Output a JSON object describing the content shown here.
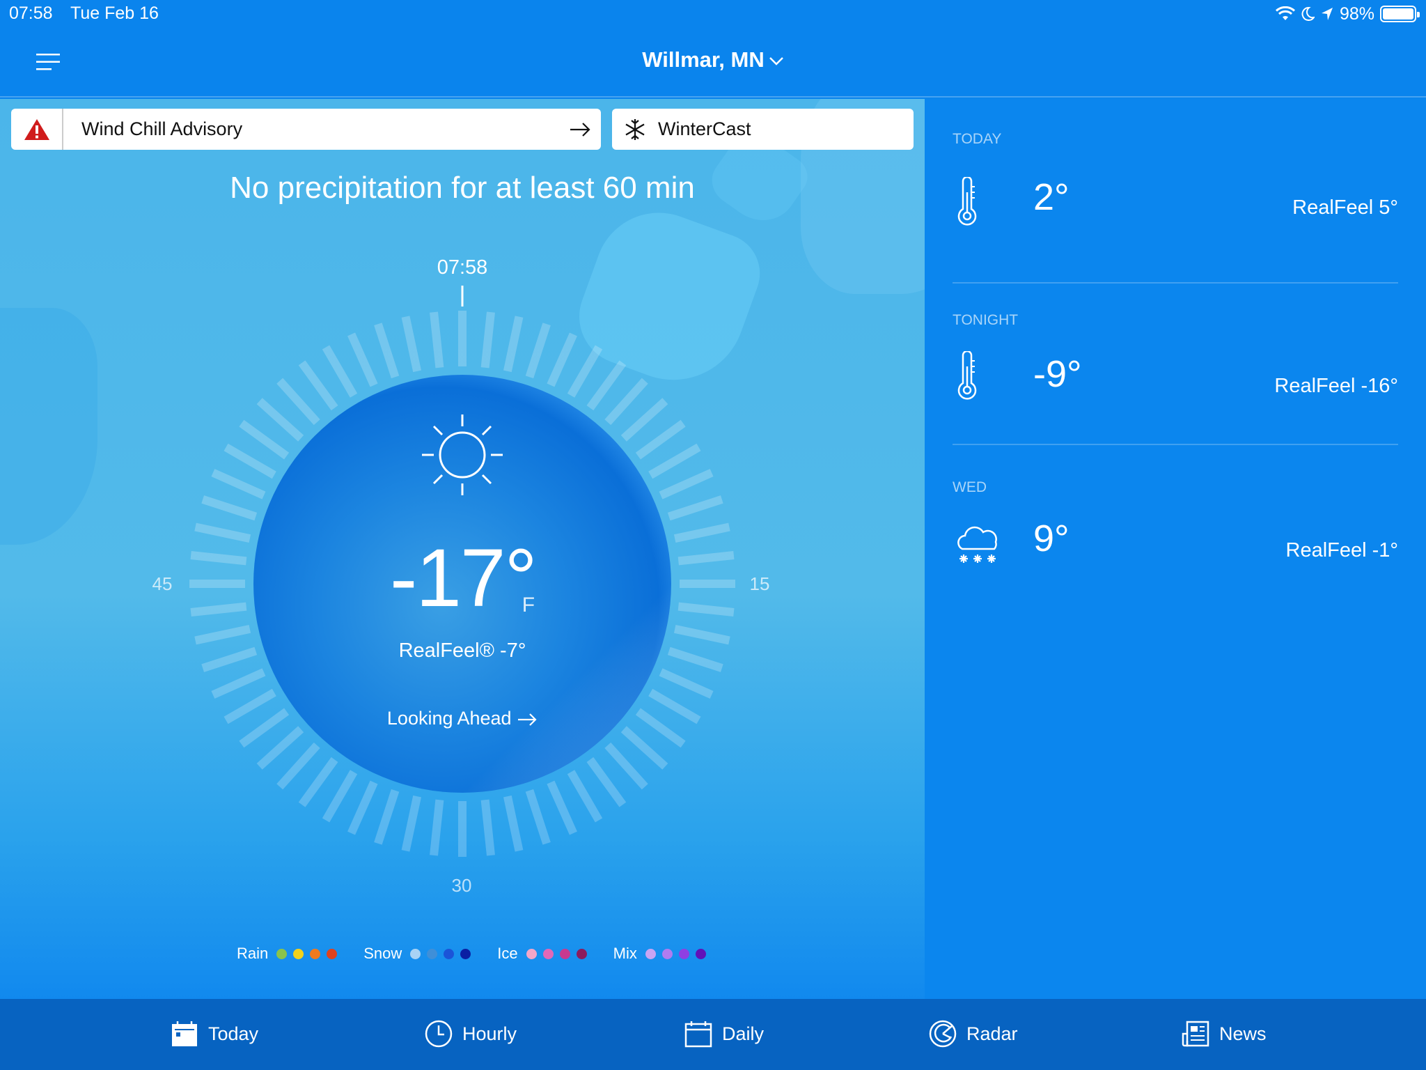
{
  "status_bar": {
    "time": "07:58",
    "date": "Tue Feb 16",
    "battery": "98%"
  },
  "header": {
    "location": "Willmar, MN"
  },
  "alerts": {
    "advisory": "Wind Chill Advisory",
    "wintercast": "WinterCast"
  },
  "minutecast": {
    "message": "No precipitation for at least 60 min",
    "dial_time": "07:58",
    "labels": {
      "left": "45",
      "right": "15",
      "bottom": "30"
    }
  },
  "current": {
    "temp": "-17°",
    "unit": "F",
    "realfeel": "RealFeel® -7°",
    "looking_ahead": "Looking Ahead"
  },
  "legend": {
    "rain": {
      "label": "Rain",
      "colors": [
        "#8bc34a",
        "#f2d21b",
        "#f07a1e",
        "#e0421d"
      ]
    },
    "snow": {
      "label": "Snow",
      "colors": [
        "#a9d3f5",
        "#3f8fd8",
        "#1b54d8",
        "#0a1fa3"
      ]
    },
    "ice": {
      "label": "Ice",
      "colors": [
        "#f4a6c8",
        "#e168b7",
        "#c8398f",
        "#8c1b5d"
      ]
    },
    "mix": {
      "label": "Mix",
      "colors": [
        "#c9a4f3",
        "#b07cf0",
        "#8f3fe2",
        "#6111b8"
      ]
    }
  },
  "forecast": [
    {
      "label": "TODAY",
      "temp": "2°",
      "realfeel": "RealFeel 5°",
      "icon": "thermometer-icon"
    },
    {
      "label": "TONIGHT",
      "temp": "-9°",
      "realfeel": "RealFeel -16°",
      "icon": "thermometer-icon"
    },
    {
      "label": "WED",
      "temp": "9°",
      "realfeel": "RealFeel -1°",
      "icon": "cloud-snow-icon"
    }
  ],
  "tabs": [
    {
      "label": "Today",
      "icon": "calendar-today-icon"
    },
    {
      "label": "Hourly",
      "icon": "clock-icon"
    },
    {
      "label": "Daily",
      "icon": "calendar-icon"
    },
    {
      "label": "Radar",
      "icon": "radar-icon"
    },
    {
      "label": "News",
      "icon": "news-icon"
    }
  ]
}
